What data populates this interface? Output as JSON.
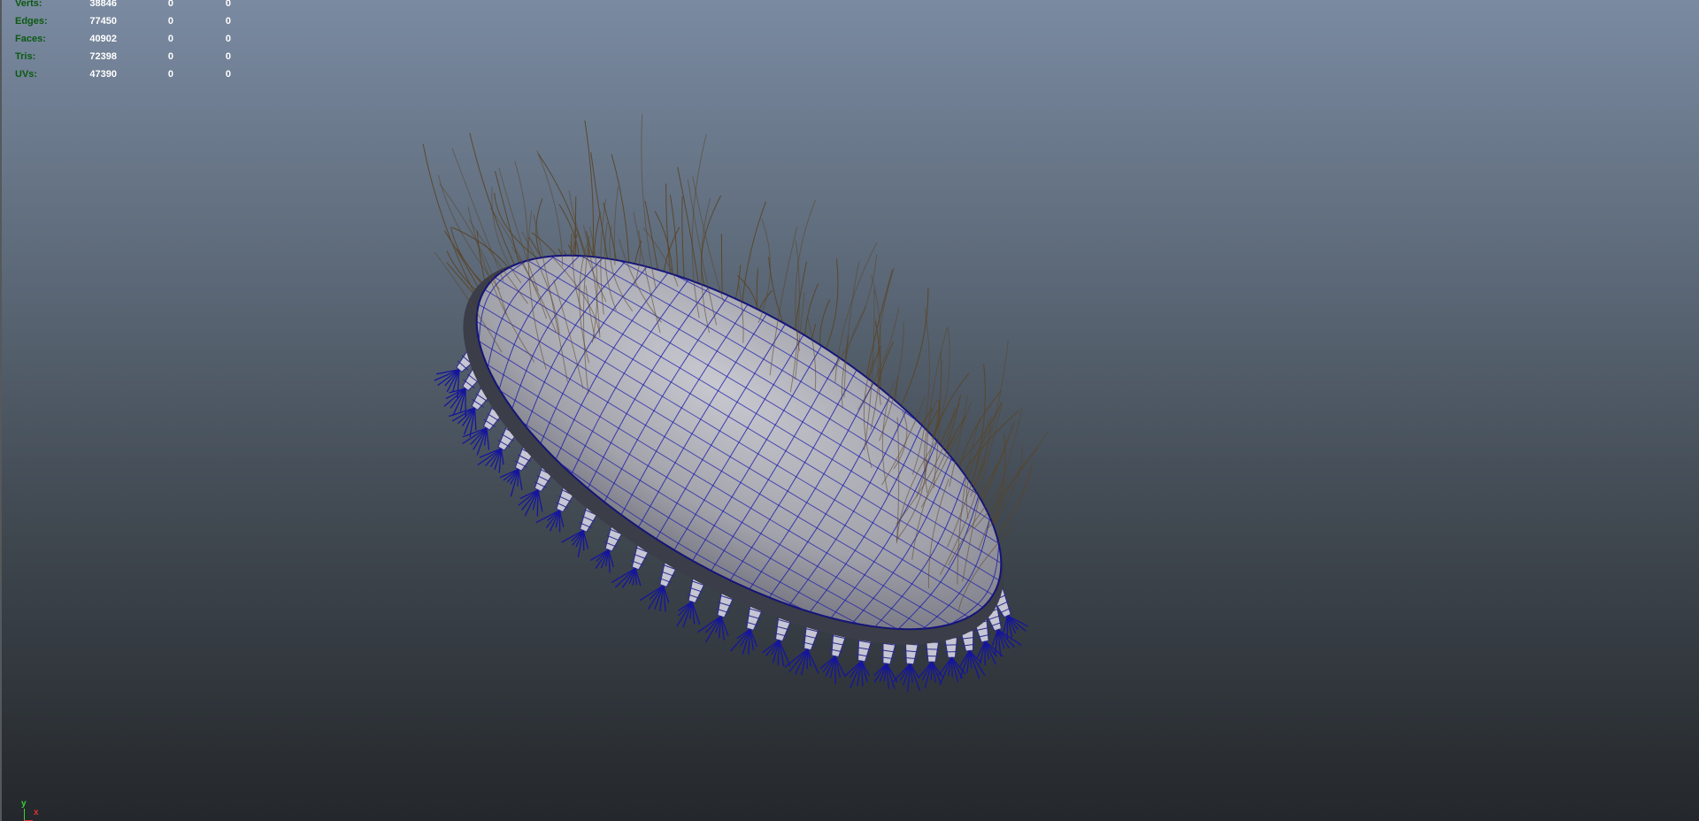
{
  "hud": {
    "rows": [
      {
        "label": "Verts:",
        "v0": "38846",
        "v1": "0",
        "v2": "0"
      },
      {
        "label": "Edges:",
        "v0": "77450",
        "v1": "0",
        "v2": "0"
      },
      {
        "label": "Faces:",
        "v0": "40902",
        "v1": "0",
        "v2": "0"
      },
      {
        "label": "Tris:",
        "v0": "72398",
        "v1": "0",
        "v2": "0"
      },
      {
        "label": "UVs:",
        "v0": "47390",
        "v1": "0",
        "v2": "0"
      }
    ]
  },
  "axis": {
    "y": "y",
    "x": "x"
  },
  "colors": {
    "hud_label": "#0b5a10",
    "wireframe": "#1a1aa8",
    "hair": "#5a4628",
    "body_fill": "#a9a9b2"
  }
}
